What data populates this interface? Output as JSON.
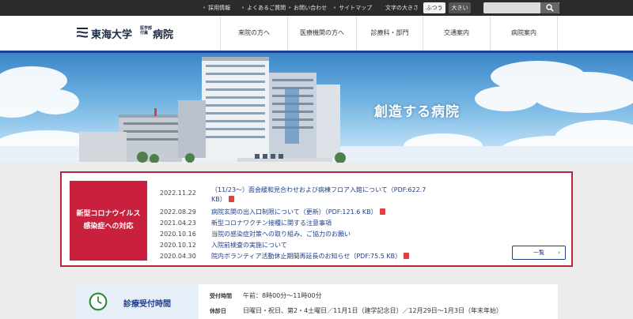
{
  "utility_links": [
    {
      "label": "採用情報"
    },
    {
      "label": "よくあるご質問"
    },
    {
      "label": "お問い合わせ"
    },
    {
      "label": "サイトマップ"
    }
  ],
  "font_size": {
    "label": "文字の大きさ",
    "normal": "ふつう",
    "large": "大きい"
  },
  "search": {
    "placeholder": "",
    "icon": "search-icon"
  },
  "logo": {
    "main": "東海大学",
    "small": "医学部付属",
    "suffix": "病院"
  },
  "nav": [
    {
      "label": "来院の方へ"
    },
    {
      "label": "医療機関の方へ"
    },
    {
      "label": "診療科・部門"
    },
    {
      "label": "交通案内"
    },
    {
      "label": "病院案内"
    }
  ],
  "hero": {
    "title": "創造する病院"
  },
  "covid": {
    "tag_line1": "新型コロナウイルス",
    "tag_line2": "感染症への対応",
    "news": [
      {
        "date": "2022.11.22",
        "title": "（11/23〜）面会緩和見合わせおよび病棟フロア入館について（PDF:622.7",
        "title2": "KB）",
        "pdf": true
      },
      {
        "date": "2022.08.29",
        "title": "病院玄関の出入口制限について（更新）（PDF:121.6 KB）",
        "pdf": true
      },
      {
        "date": "2021.04.23",
        "title": "新型コロナワクチン接種に関する注意事項",
        "pdf": false
      },
      {
        "date": "2020.10.16",
        "title": "当院の感染症対策への取り組み、ご協力のお願い",
        "pdf": false
      },
      {
        "date": "2020.10.12",
        "title": "入院前検査の実施について",
        "pdf": false
      },
      {
        "date": "2020.04.30",
        "title": "院内ボランティア活動休止期間再延長のお知らせ（PDF:75.5 KB）",
        "pdf": true
      }
    ],
    "more": "一覧"
  },
  "hours": {
    "title": "診療受付時間",
    "rows": [
      {
        "label": "受付時間",
        "value": "午前：8時00分〜11時00分"
      },
      {
        "label": "休診日",
        "value": "日曜日・祝日、第2・4土曜日／11月1日（建学記念日）／12月29日〜1月3日（年末年始）"
      }
    ]
  },
  "colors": {
    "accent": "#1c3f94",
    "covid": "#c8203d",
    "topbar": "#2b2b2b"
  }
}
